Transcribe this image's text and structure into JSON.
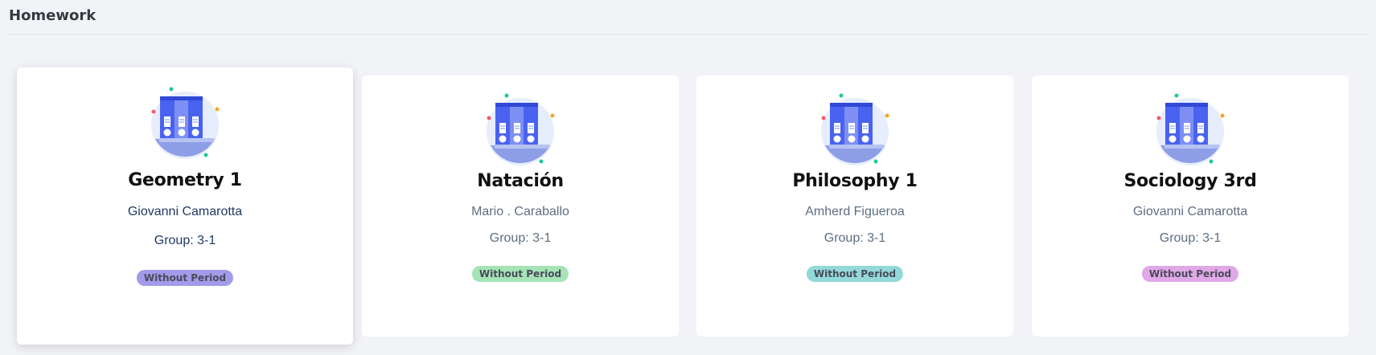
{
  "page": {
    "title": "Homework"
  },
  "cards": [
    {
      "name": "Geometry 1",
      "teacher": "Giovanni Camarotta",
      "group": "Group: 3-1",
      "badge": "Without Period",
      "badge_color": "#a29bea"
    },
    {
      "name": "Natación",
      "teacher": "Mario . Caraballo",
      "group": "Group: 3-1",
      "badge": "Without Period",
      "badge_color": "#a6e3b7"
    },
    {
      "name": "Philosophy 1",
      "teacher": "Amherd Figueroa",
      "group": "Group: 3-1",
      "badge": "Without Period",
      "badge_color": "#93d9d9"
    },
    {
      "name": "Sociology 3rd",
      "teacher": "Giovanni Camarotta",
      "group": "Group: 3-1",
      "badge": "Without Period",
      "badge_color": "#e0a8e6"
    }
  ],
  "illustration": {
    "icon": "binders-icon"
  }
}
